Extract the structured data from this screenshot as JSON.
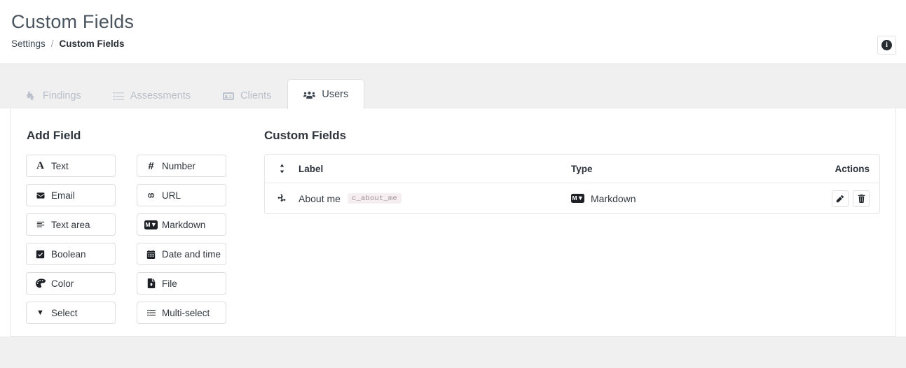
{
  "header": {
    "title": "Custom Fields",
    "breadcrumb": {
      "parent": "Settings",
      "separator": "/",
      "current": "Custom Fields"
    },
    "info_icon": "info-circle-icon",
    "info_glyph": "i"
  },
  "tabs": [
    {
      "label": "Findings",
      "icon": "bug-icon",
      "active": false
    },
    {
      "label": "Assessments",
      "icon": "list-icon",
      "active": false
    },
    {
      "label": "Clients",
      "icon": "id-card-icon",
      "active": false
    },
    {
      "label": "Users",
      "icon": "users-icon",
      "active": true
    }
  ],
  "add_field": {
    "title": "Add Field",
    "buttons": [
      {
        "label": "Text",
        "icon": "font-icon"
      },
      {
        "label": "Number",
        "icon": "hashtag-icon"
      },
      {
        "label": "Email",
        "icon": "envelope-icon"
      },
      {
        "label": "URL",
        "icon": "link-icon"
      },
      {
        "label": "Text area",
        "icon": "align-left-icon"
      },
      {
        "label": "Markdown",
        "icon": "markdown-icon"
      },
      {
        "label": "Boolean",
        "icon": "check-square-icon"
      },
      {
        "label": "Date and time",
        "icon": "calendar-icon"
      },
      {
        "label": "Color",
        "icon": "palette-icon"
      },
      {
        "label": "File",
        "icon": "file-upload-icon"
      },
      {
        "label": "Select",
        "icon": "caret-down-icon"
      },
      {
        "label": "Multi-select",
        "icon": "list-ul-icon"
      }
    ]
  },
  "custom_fields": {
    "title": "Custom Fields",
    "columns": {
      "sort": "sort-icon",
      "label": "Label",
      "type": "Type",
      "actions": "Actions"
    },
    "rows": [
      {
        "drag_handle": "arrows-move-icon",
        "label": "About me",
        "code": "c_about_me",
        "type": "Markdown",
        "type_icon": "markdown-icon",
        "edit_label": "edit-icon",
        "delete_label": "trash-icon"
      }
    ]
  },
  "colors": {
    "page_background": "#ffffff",
    "shell_background": "#f0f0f0",
    "title_text": "#4a545e",
    "tab_inactive_text": "#b9c0ca",
    "tab_active_text": "#3d4650",
    "border": "#e6e6e6",
    "badge_background": "#f6eff1",
    "badge_text": "#9b8f93"
  }
}
